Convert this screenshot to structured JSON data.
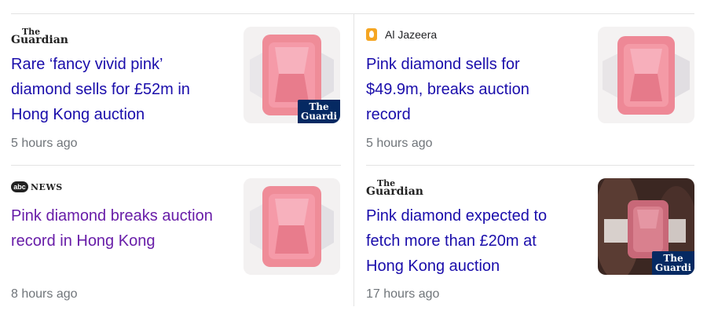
{
  "colors": {
    "link": "#1a0dab",
    "visited": "#681da8",
    "time": "#70757a"
  },
  "cards": [
    {
      "source": "The Guardian",
      "headline_lines": [
        "Rare ‘fancy vivid pink’",
        "diamond sells for £52m in",
        "Hong Kong auction"
      ],
      "time": "5 hours ago",
      "thumb_badge": "The Guardi",
      "visited": false
    },
    {
      "source": "Al Jazeera",
      "headline_lines": [
        "Pink diamond sells for",
        "$49.9m, breaks auction",
        "record"
      ],
      "time": "5 hours ago",
      "visited": false
    },
    {
      "source": "abc NEWS",
      "headline_lines": [
        "Pink diamond breaks auction",
        "record in Hong Kong"
      ],
      "time": "8 hours ago",
      "visited": true
    },
    {
      "source": "The Guardian",
      "headline_lines": [
        "Pink diamond expected to",
        "fetch more than £20m at",
        "Hong Kong auction"
      ],
      "time": "17 hours ago",
      "thumb_badge": "The Guardi",
      "visited": false
    }
  ]
}
